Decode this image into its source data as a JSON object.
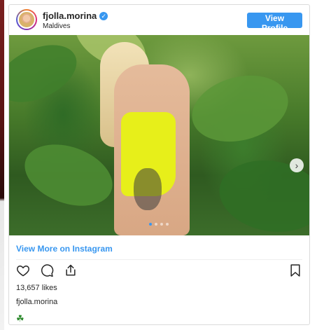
{
  "post": {
    "username": "fjolla.morina",
    "location": "Maldives",
    "view_profile_label": "View Profile",
    "view_more_label": "View More on Instagram",
    "likes": "13,657 likes",
    "caption_user": "fjolla.morina",
    "caption_emoji": "☘",
    "carousel_total": 4,
    "carousel_active_index": 0
  },
  "icons": {
    "verified": "verified-badge-icon",
    "like": "heart-icon",
    "comment": "comment-icon",
    "share": "share-icon",
    "save": "bookmark-icon",
    "next": "chevron-right-icon"
  },
  "colors": {
    "accent": "#3897f0",
    "text": "#262626",
    "border": "#dbdbdb"
  }
}
